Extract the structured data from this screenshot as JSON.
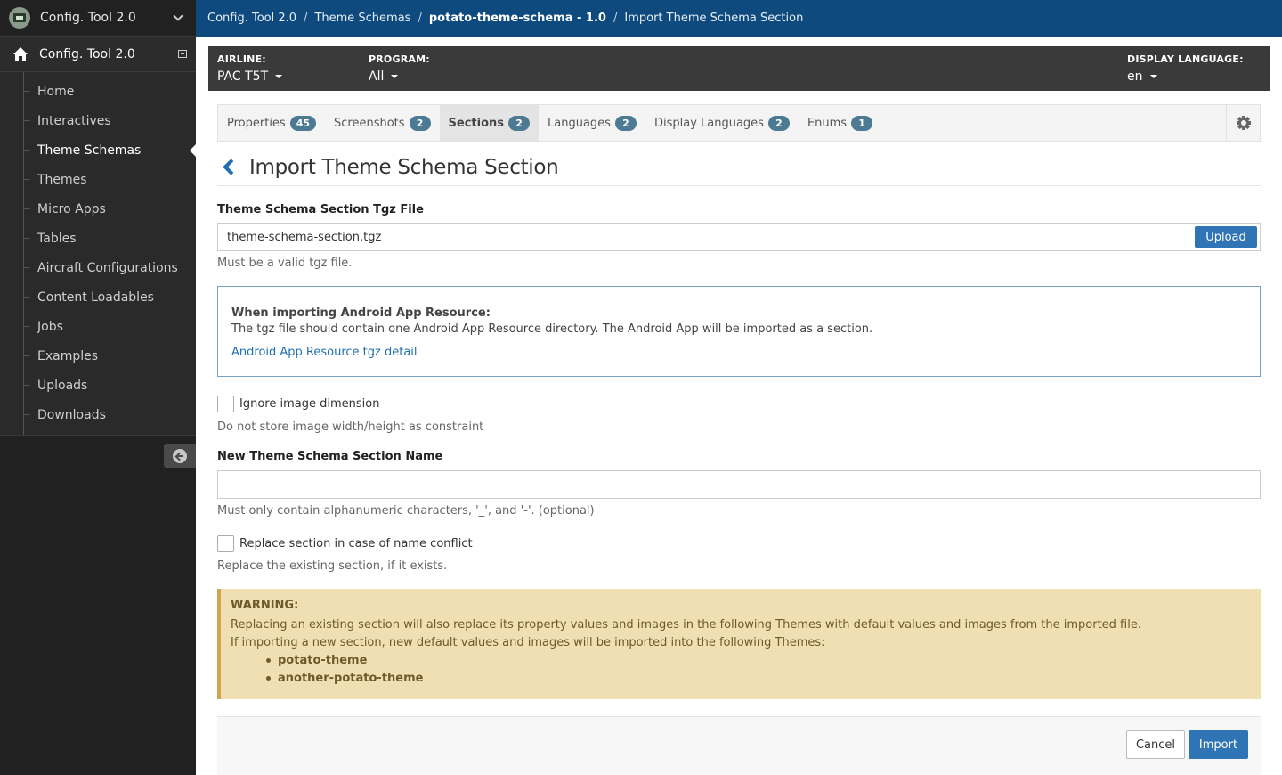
{
  "sidebar": {
    "top_title": "Config. Tool 2.0",
    "app_title": "Config. Tool 2.0",
    "items": [
      {
        "label": "Home",
        "active": false
      },
      {
        "label": "Interactives",
        "active": false
      },
      {
        "label": "Theme Schemas",
        "active": true
      },
      {
        "label": "Themes",
        "active": false
      },
      {
        "label": "Micro Apps",
        "active": false
      },
      {
        "label": "Tables",
        "active": false
      },
      {
        "label": "Aircraft Configurations",
        "active": false
      },
      {
        "label": "Content Loadables",
        "active": false
      },
      {
        "label": "Jobs",
        "active": false
      },
      {
        "label": "Examples",
        "active": false
      },
      {
        "label": "Uploads",
        "active": false
      },
      {
        "label": "Downloads",
        "active": false
      }
    ]
  },
  "breadcrumb": {
    "items": [
      "Config. Tool 2.0",
      "Theme Schemas",
      "potato-theme-schema - 1.0",
      "Import Theme Schema Section"
    ],
    "separator": "/"
  },
  "filters": {
    "airline_label": "AIRLINE:",
    "airline_value": "PAC T5T",
    "program_label": "PROGRAM:",
    "program_value": "All",
    "display_language_label": "DISPLAY LANGUAGE:",
    "display_language_value": "en"
  },
  "tabs": [
    {
      "label": "Properties",
      "count": "45",
      "active": false
    },
    {
      "label": "Screenshots",
      "count": "2",
      "active": false
    },
    {
      "label": "Sections",
      "count": "2",
      "active": true
    },
    {
      "label": "Languages",
      "count": "2",
      "active": false
    },
    {
      "label": "Display Languages",
      "count": "2",
      "active": false
    },
    {
      "label": "Enums",
      "count": "1",
      "active": false
    }
  ],
  "page": {
    "title": "Import Theme Schema Section"
  },
  "form": {
    "file_label": "Theme Schema Section Tgz File",
    "file_value": "theme-schema-section.tgz",
    "upload_label": "Upload",
    "file_help": "Must be a valid tgz file.",
    "info_title": "When importing Android App Resource:",
    "info_text": "The tgz file should contain one Android App Resource directory. The Android App will be imported as a section.",
    "info_link": "Android App Resource tgz detail",
    "ignore_label": "Ignore image dimension",
    "ignore_help": "Do not store image width/height as constraint",
    "name_label": "New Theme Schema Section Name",
    "name_value": "",
    "name_help": "Must only contain alphanumeric characters, '_', and '-'. (optional)",
    "replace_label": "Replace section in case of name conflict",
    "replace_help": "Replace the existing section, if it exists."
  },
  "warning": {
    "title": "WARNING:",
    "line1": "Replacing an existing section will also replace its property values and images in the following Themes with default values and images from the imported file.",
    "line2": "If importing a new section, new default values and images will be imported into the following Themes:",
    "themes": [
      "potato-theme",
      "another-potato-theme"
    ]
  },
  "footer": {
    "cancel_label": "Cancel",
    "import_label": "Import"
  },
  "colors": {
    "topbar": "#0e4a7e",
    "sidebar": "#212121",
    "primary": "#2f74b5",
    "badge": "#4d7a93",
    "warning_bg": "#f0dfb2"
  }
}
